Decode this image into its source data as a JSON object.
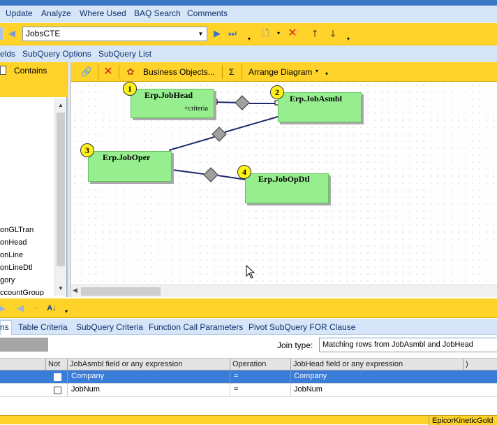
{
  "menu": {
    "items": [
      "Update",
      "Analyze",
      "Where Used",
      "BAQ Search",
      "Comments"
    ]
  },
  "toolbar": {
    "query_value": "JobsCTE"
  },
  "subnav": {
    "items": [
      "elds",
      "SubQuery Options",
      "SubQuery List"
    ]
  },
  "left_panel": {
    "contains_label": "Contains",
    "list_items": [
      "onGLTran",
      "onHead",
      "onLine",
      "onLineDtl",
      "gory",
      "ccountGroup"
    ]
  },
  "diagram_toolbar": {
    "business_objects_label": "Business Objects...",
    "sigma_label": "Σ",
    "arrange_label": "Arrange Diagram"
  },
  "diagram": {
    "tables": [
      {
        "number": "1",
        "name": "Erp.JobHead"
      },
      {
        "number": "2",
        "name": "Erp.JobAsmbl"
      },
      {
        "number": "3",
        "name": "Erp.JobOper"
      },
      {
        "number": "4",
        "name": "Erp.JobOpDtl"
      }
    ],
    "criteria_label": "+criteria",
    "table_color": "#96ee8e",
    "badge_color": "#fff21a"
  },
  "tabs": {
    "active_fragment": "ns",
    "items": [
      "Table Criteria",
      "SubQuery Criteria",
      "Function Call Parameters",
      "Pivot SubQuery FOR Clause"
    ]
  },
  "join": {
    "label": "Join type:",
    "value": "Matching rows from JobAsmbl and JobHead"
  },
  "grid": {
    "columns": [
      "Not",
      "JobAsmbl field or any expression",
      "Operation",
      "JobHead field or any expression",
      ")"
    ],
    "rows": [
      {
        "left": "Company",
        "op": "=",
        "right": "Company",
        "selected": true
      },
      {
        "left": "JobNum",
        "op": "=",
        "right": "JobNum",
        "selected": false
      }
    ]
  },
  "status": {
    "text": "EpicorKineticGold"
  },
  "colors": {
    "accent_yellow": "#ffd32a",
    "nav_blue": "#d6e6f8",
    "selected_row": "#3a7dd8"
  }
}
